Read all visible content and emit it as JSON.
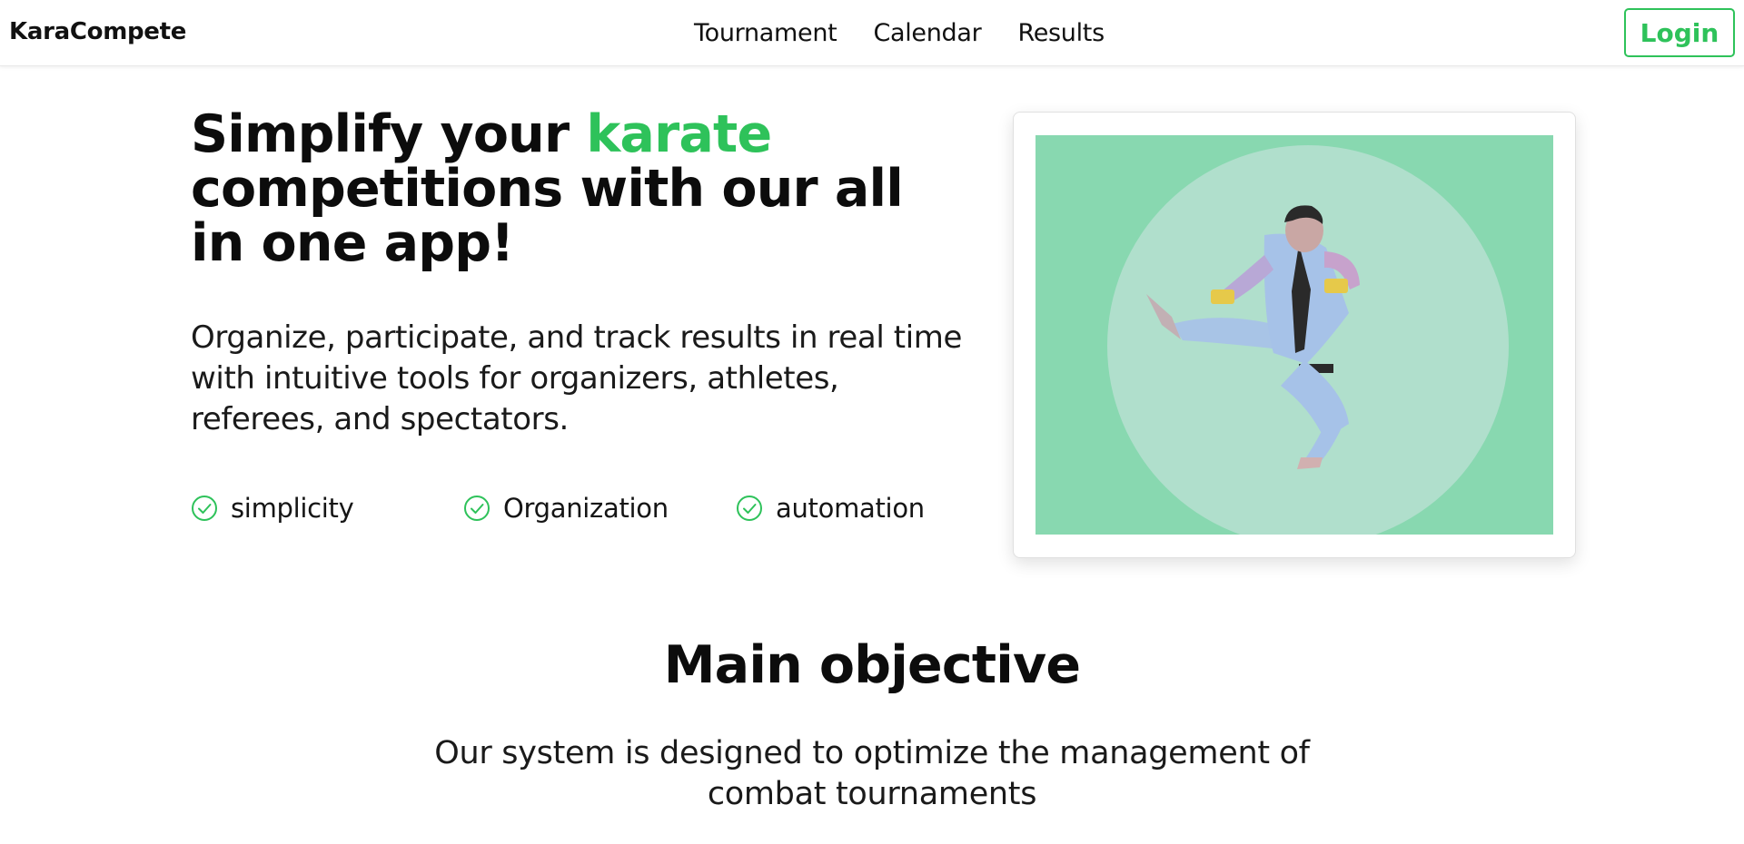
{
  "navbar": {
    "brand": "KaraCompete",
    "links": [
      "Tournament",
      "Calendar",
      "Results"
    ],
    "login_label": "Login"
  },
  "hero": {
    "title_part1": "Simplify your ",
    "title_accent": "karate",
    "title_part2": " competitions with our all in one app!",
    "subtitle": "Organize, participate, and track results in real time with intuitive tools for organizers, athletes, referees, and spectators.",
    "features": [
      {
        "label": "simplicity",
        "icon": "check-circle-icon"
      },
      {
        "label": "Organization",
        "icon": "check-circle-icon"
      },
      {
        "label": "automation",
        "icon": "check-circle-icon"
      }
    ],
    "image_subject": "karate-athlete-flying-kick"
  },
  "objective": {
    "title": "Main objective",
    "text": "Our system is designed to optimize the management of combat tournaments"
  },
  "colors": {
    "accent": "#2ec25a",
    "image_background": "#88d8b0",
    "image_circle": "#b0dfcc"
  }
}
